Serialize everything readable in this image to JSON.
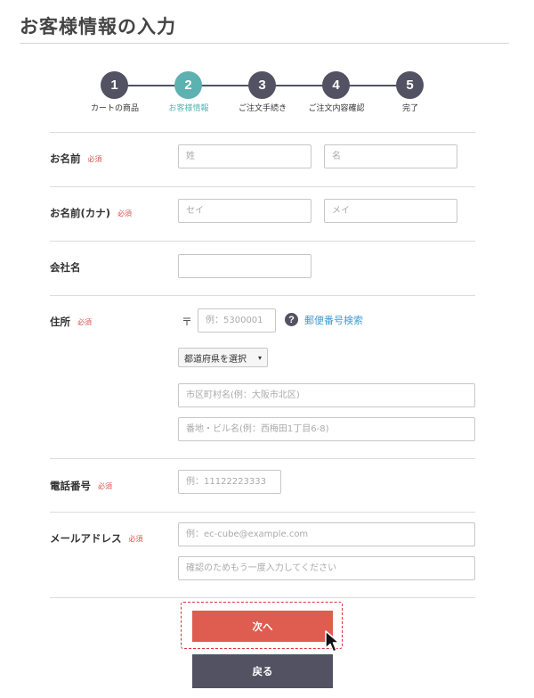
{
  "page": {
    "title": "お客様情報の入力"
  },
  "stepper": {
    "steps": [
      {
        "number": "1",
        "label": "カートの商品"
      },
      {
        "number": "2",
        "label": "お客様情報"
      },
      {
        "number": "3",
        "label": "ご注文手続き"
      },
      {
        "number": "4",
        "label": "ご注文内容確認"
      },
      {
        "number": "5",
        "label": "完了"
      }
    ],
    "active_step": 2,
    "colors": {
      "default": "#525263",
      "active": "#5cb1b1"
    }
  },
  "form": {
    "required_badge": "必須",
    "name": {
      "label": "お名前",
      "last_placeholder": "姓",
      "first_placeholder": "名",
      "last_value": "",
      "first_value": ""
    },
    "kana": {
      "label": "お名前(カナ)",
      "last_placeholder": "セイ",
      "first_placeholder": "メイ",
      "last_value": "",
      "first_value": ""
    },
    "company": {
      "label": "会社名",
      "value": ""
    },
    "address": {
      "label": "住所",
      "postal_mark": "〒",
      "zip_placeholder": "例：5300001",
      "zip_value": "",
      "zip_lookup_link": "郵便番号検索",
      "help_icon": "question-icon",
      "prefecture_selected": "都道府県を選択",
      "city_placeholder": "市区町村名(例：大阪市北区)",
      "street_placeholder": "番地・ビル名(例：西梅田1丁目6-8)"
    },
    "phone": {
      "label": "電話番号",
      "placeholder": "例：11122223333",
      "value": ""
    },
    "email": {
      "label": "メールアドレス",
      "placeholder": "例：ec-cube@example.com",
      "confirm_placeholder": "確認のためもう一度入力してください",
      "value": "",
      "confirm_value": ""
    }
  },
  "actions": {
    "next_label": "次へ",
    "back_label": "戻る",
    "colors": {
      "next": "#de5d50",
      "back": "#525263",
      "highlight": "#e0303a"
    }
  }
}
